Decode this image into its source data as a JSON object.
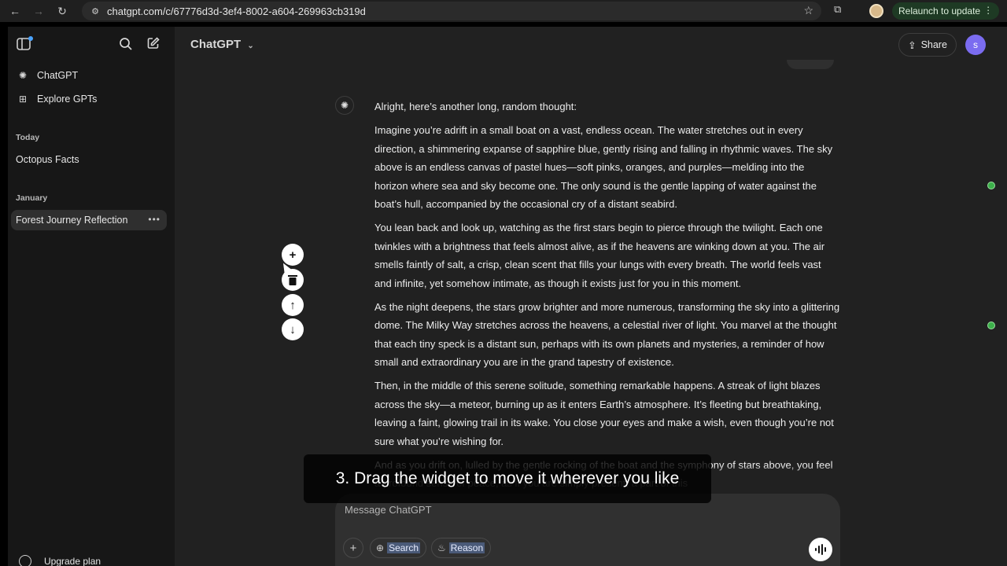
{
  "browser": {
    "url": "chatgpt.com/c/67776d3d-3ef4-8002-a604-269963cb319d",
    "relaunch_label": "Relaunch to update"
  },
  "sidebar": {
    "items": [
      {
        "label": "ChatGPT",
        "icon": "chatgpt-logo-icon"
      },
      {
        "label": "Explore GPTs",
        "icon": "grid-icon"
      }
    ],
    "sections": [
      {
        "title": "Today",
        "chats": [
          "Octopus Facts"
        ]
      },
      {
        "title": "January",
        "chats": [
          "Forest Journey Reflection"
        ]
      }
    ],
    "upgrade_label": "Upgrade plan"
  },
  "header": {
    "model_title": "ChatGPT",
    "share_label": "Share",
    "avatar_letter": "s"
  },
  "message": {
    "paragraphs": [
      "Alright, here’s another long, random thought:",
      "Imagine you’re adrift in a small boat on a vast, endless ocean. The water stretches out in every direction, a shimmering expanse of sapphire blue, gently rising and falling in rhythmic waves. The sky above is an endless canvas of pastel hues—soft pinks, oranges, and purples—melding into the horizon where sea and sky become one. The only sound is the gentle lapping of water against the boat’s hull, accompanied by the occasional cry of a distant seabird.",
      "You lean back and look up, watching as the first stars begin to pierce through the twilight. Each one twinkles with a brightness that feels almost alive, as if the heavens are winking down at you. The air smells faintly of salt, a crisp, clean scent that fills your lungs with every breath. The world feels vast and infinite, yet somehow intimate, as though it exists just for you in this moment.",
      "As the night deepens, the stars grow brighter and more numerous, transforming the sky into a glittering dome. The Milky Way stretches across the heavens, a celestial river of light. You marvel at the thought that each tiny speck is a distant sun, perhaps with its own planets and mysteries, a reminder of how small and extraordinary you are in the grand tapestry of existence.",
      "Then, in the middle of this serene solitude, something remarkable happens. A streak of light blazes across the sky—a meteor, burning up as it enters Earth’s atmosphere. It’s fleeting but breathtaking, leaving a faint, glowing trail in its wake. You close your eyes and make a wish, even though you’re not sure what you’re wishing for.",
      "And as you drift on, lulled by the gentle rocking of the boat and the symphony of stars above, you feel a profound sense of peace, as if you are simply present, a part of this"
    ]
  },
  "composer": {
    "placeholder": "Message ChatGPT",
    "search_label": "Search",
    "reason_label": "Reason"
  },
  "caption": "3. Drag the widget to move it wherever you like"
}
